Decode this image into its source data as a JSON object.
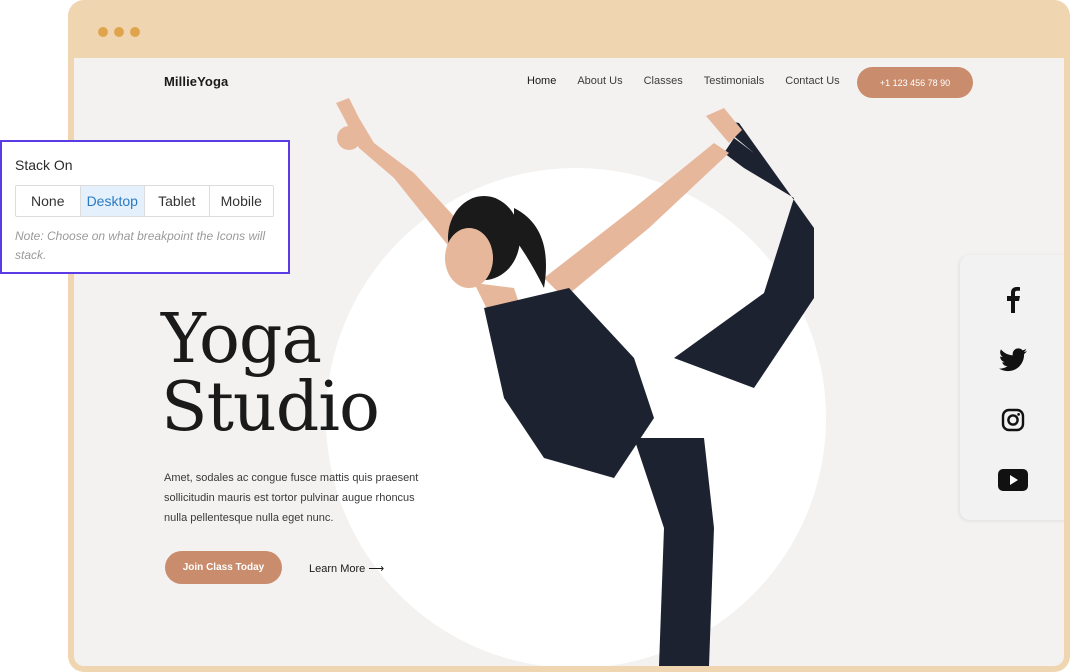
{
  "header": {
    "logo": "MillieYoga",
    "nav": [
      "Home",
      "About Us",
      "Classes",
      "Testimonials",
      "Contact Us"
    ],
    "phone": "+1 123 456 78 90"
  },
  "hero": {
    "title_line1": "Yoga",
    "title_line2": "Studio",
    "description": "Amet, sodales ac congue fusce mattis quis praesent sollicitudin mauris est tortor pulvinar augue rhoncus nulla pellentesque nulla eget nunc.",
    "join_label": "Join Class Today",
    "learn_more_label": "Learn More",
    "learn_more_arrow": "⟶"
  },
  "social": {
    "icons": [
      "facebook-icon",
      "twitter-icon",
      "instagram-icon",
      "youtube-icon"
    ]
  },
  "stack_panel": {
    "label": "Stack On",
    "options": [
      "None",
      "Desktop",
      "Tablet",
      "Mobile"
    ],
    "selected": "Desktop",
    "note": "Note: Choose on what breakpoint the Icons will stack."
  },
  "colors": {
    "frame": "#f0d6b0",
    "accent": "#c98c6c",
    "panel_border": "#5b3be6",
    "selected_bg": "#e4f0fb"
  }
}
